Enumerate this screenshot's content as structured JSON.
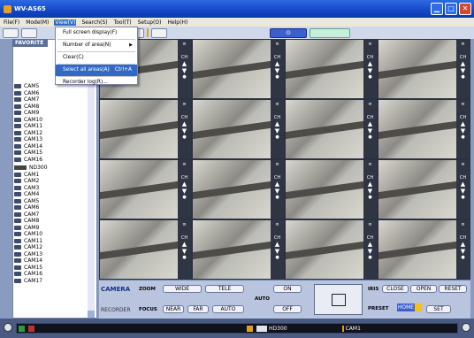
{
  "window": {
    "title": "WV-AS65"
  },
  "menubar": [
    {
      "label": "File(F)"
    },
    {
      "label": "Mode(M)"
    },
    {
      "label": "View(V)"
    },
    {
      "label": "Search(S)"
    },
    {
      "label": "Tool(T)"
    },
    {
      "label": "Setup(O)"
    },
    {
      "label": "Help(H)"
    }
  ],
  "view_menu": [
    {
      "label": "Full screen display(F)",
      "shortcut": ""
    },
    {
      "label": "Number of area(N)",
      "shortcut": ""
    },
    {
      "label": "Clear(C)",
      "shortcut": ""
    },
    {
      "label": "Select all areas(A)",
      "shortcut": "Ctrl+A"
    },
    {
      "label": "Recorder log(R)...",
      "shortcut": ""
    }
  ],
  "sidebar": {
    "tab": "FAVORITE",
    "tree": [
      "CAM5",
      "CAM6",
      "CAM7",
      "CAM8",
      "CAM9",
      "CAM10",
      "CAM11",
      "CAM12",
      "CAM13",
      "CAM14",
      "CAM15",
      "CAM16"
    ],
    "recorder": "ND300",
    "recorder_cams": [
      "CAM1",
      "CAM2",
      "CAM3",
      "CAM4",
      "CAM5",
      "CAM6",
      "CAM7",
      "CAM8",
      "CAM9",
      "CAM10",
      "CAM11",
      "CAM12",
      "CAM13",
      "CAM14",
      "CAM15",
      "CAM16",
      "CAM17"
    ]
  },
  "grid": {
    "ch_label": "CH"
  },
  "panel": {
    "camera_tab": "CAMERA",
    "recorder_tab": "RECORDER",
    "zoom_label": "ZOOM",
    "wide": "WIDE",
    "tele": "TELE",
    "focus_label": "FOCUS",
    "near": "NEAR",
    "far": "FAR",
    "auto": "AUTO",
    "auto_label": "AUTO",
    "on": "ON",
    "off": "OFF",
    "iris_label": "IRIS",
    "close": "CLOSE",
    "open": "OPEN",
    "reset": "RESET",
    "preset_label": "PRESET",
    "home": "HOME",
    "set": "SET"
  },
  "statusbar": {
    "recorder": "HD300",
    "camera": "CAM1"
  }
}
